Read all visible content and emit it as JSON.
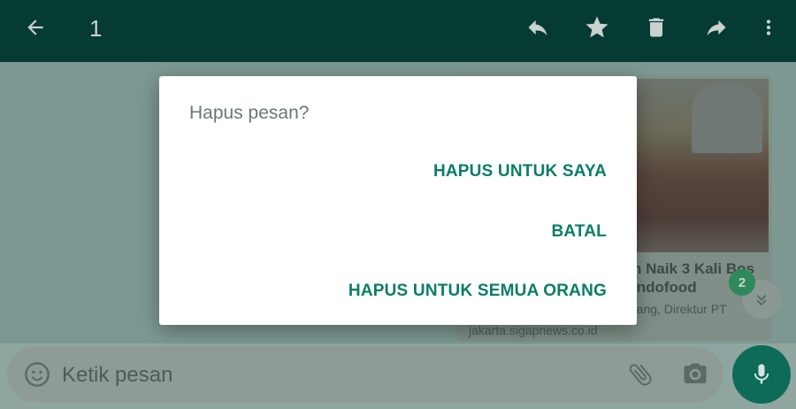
{
  "topbar": {
    "selected_count": "1",
    "icons": [
      "back-arrow-icon",
      "reply-icon",
      "star-icon",
      "delete-icon",
      "forward-icon",
      "more-vert-icon"
    ],
    "background": "#063b33"
  },
  "chat": {
    "preview_title": "n Naik 3 Kali Bos Indofood",
    "preview_desc": "rang, Direktur PT",
    "preview_link": "jakarta.sigapnews.co.id",
    "unread_badge": "2"
  },
  "composer": {
    "placeholder": "Ketik pesan"
  },
  "dialog": {
    "title": "Hapus pesan?",
    "delete_for_me": "HAPUS UNTUK SAYA",
    "cancel": "BATAL",
    "delete_for_everyone": "HAPUS UNTUK SEMUA ORANG",
    "accent": "#0a7d68"
  }
}
